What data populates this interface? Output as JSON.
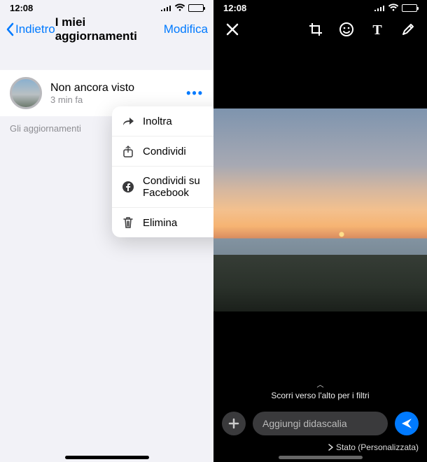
{
  "left": {
    "time": "12:08",
    "back": "Indietro",
    "title": "I miei aggiornamenti",
    "edit": "Modifica",
    "status": {
      "title": "Non ancora visto",
      "subtitle": "3 min fa"
    },
    "footerNote": "Gli aggiornamenti",
    "menu": {
      "forward": "Inoltra",
      "share": "Condividi",
      "shareFb": "Condividi su Facebook",
      "delete": "Elimina"
    }
  },
  "right": {
    "time": "12:08",
    "filtersHint": "Scorri verso l'alto per i filtri",
    "captionPlaceholder": "Aggiungi didascalia",
    "privacyLabel": "Stato (Personalizzata)"
  }
}
